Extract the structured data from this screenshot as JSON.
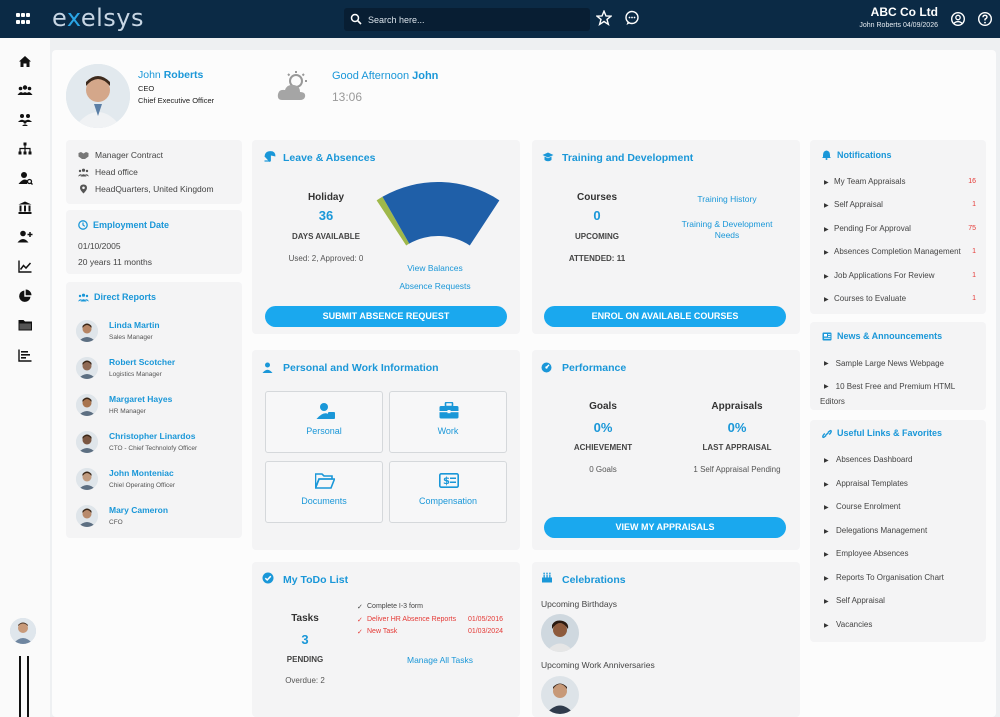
{
  "topbar": {
    "logo_prefix": "e",
    "logo_x": "x",
    "logo_rest": "elsys",
    "search_placeholder": "Search here...",
    "company": "ABC Co Ltd",
    "user_date": "John Roberts 04/09/2026"
  },
  "profile": {
    "first_name": "John",
    "last_name": "Roberts",
    "role": "CEO",
    "title": "Chief Executive Officer"
  },
  "greeting": {
    "prefix": "Good Afternoon",
    "name": "John",
    "time": "13:06"
  },
  "info": {
    "contract": "Manager Contract",
    "office": "Head office",
    "location": "HeadQuarters, United Kingdom"
  },
  "employment": {
    "title": "Employment Date",
    "date": "01/10/2005",
    "tenure": "20 years 11 months"
  },
  "direct_reports": {
    "title": "Direct Reports",
    "people": [
      {
        "name": "Linda Martin",
        "role": "Sales Manager"
      },
      {
        "name": "Robert Scotcher",
        "role": "Logistics Manager"
      },
      {
        "name": "Margaret Hayes",
        "role": "HR Manager"
      },
      {
        "name": "Christopher Linardos",
        "role": "CTO - Chief Technolofy Officer"
      },
      {
        "name": "John Monteniac",
        "role": "Chiel Operating Officer"
      },
      {
        "name": "Mary Cameron",
        "role": "CFO"
      }
    ]
  },
  "leave": {
    "title": "Leave & Absences",
    "type": "Holiday",
    "days": "36",
    "days_label": "DAYS AVAILABLE",
    "used": "Used: 2, Approved: 0",
    "view_balances": "View Balances",
    "absence_requests": "Absence Requests",
    "button": "SUBMIT ABSENCE REQUEST",
    "gauge": {
      "available": 36,
      "used": 2,
      "approved": 0
    }
  },
  "training": {
    "title": "Training and Development",
    "courses_label": "Courses",
    "courses": "0",
    "upcoming": "UPCOMING",
    "attended": "ATTENDED: 11",
    "history": "Training History",
    "needs": "Training & Development Needs",
    "button": "ENROL ON AVAILABLE COURSES"
  },
  "notifications": {
    "title": "Notifications",
    "items": [
      {
        "label": "My Team Appraisals",
        "count": "16"
      },
      {
        "label": "Self Appraisal",
        "count": "1"
      },
      {
        "label": "Pending For Approval",
        "count": "75"
      },
      {
        "label": "Absences Completion Management",
        "count": "1"
      },
      {
        "label": "Job Applications For Review",
        "count": "1"
      },
      {
        "label": "Courses to Evaluate",
        "count": "1"
      }
    ]
  },
  "news": {
    "title": "News & Announcements",
    "items": [
      "Sample Large News Webpage",
      "10 Best Free and Premium HTML",
      "Editors"
    ]
  },
  "links": {
    "title": "Useful Links & Favorites",
    "items": [
      "Absences Dashboard",
      "Appraisal Templates",
      "Course Enrolment",
      "Delegations Management",
      "Employee Absences",
      "Reports To Organisation Chart",
      "Self Appraisal",
      "Vacancies"
    ]
  },
  "personal": {
    "title": "Personal and Work Information",
    "tiles": [
      "Personal",
      "Work",
      "Documents",
      "Compensation"
    ]
  },
  "performance": {
    "title": "Performance",
    "goals_label": "Goals",
    "goals_value": "0%",
    "achievement": "ACHIEVEMENT",
    "goals_count": "0 Goals",
    "appraisals_label": "Appraisals",
    "appraisals_value": "0%",
    "last_appraisal": "LAST APPRAISAL",
    "pending": "1 Self Appraisal Pending",
    "button": "VIEW MY APPRAISALS"
  },
  "todo": {
    "title": "My ToDo List",
    "tasks_label": "Tasks",
    "tasks": "3",
    "pending": "PENDING",
    "overdue": "Overdue: 2",
    "manage": "Manage All Tasks",
    "items": [
      {
        "label": "Complete I-3 form",
        "date": "",
        "overdue": false
      },
      {
        "label": "Deliver HR Absence Reports",
        "date": "01/05/2016",
        "overdue": true
      },
      {
        "label": "New Task",
        "date": "01/03/2024",
        "overdue": true
      }
    ]
  },
  "celebrations": {
    "title": "Celebrations",
    "birthdays": "Upcoming Birthdays",
    "anniversaries": "Upcoming Work Anniversaries"
  },
  "colors": {
    "topbar": "#0b2a45",
    "accent": "#1a97d8",
    "button": "#1aa8ee",
    "overdue": "#e53935",
    "gauge": "#1f5fa8"
  },
  "icons": [
    "grid-icon",
    "search-icon",
    "star-icon",
    "chat-icon",
    "account-icon",
    "help-icon",
    "home-icon",
    "team-icon",
    "people-icon",
    "org-chart-icon",
    "person-search-icon",
    "bank-icon",
    "add-person-icon",
    "line-chart-icon",
    "pie-chart-icon",
    "folder-icon",
    "report-icon",
    "weather-icon"
  ]
}
